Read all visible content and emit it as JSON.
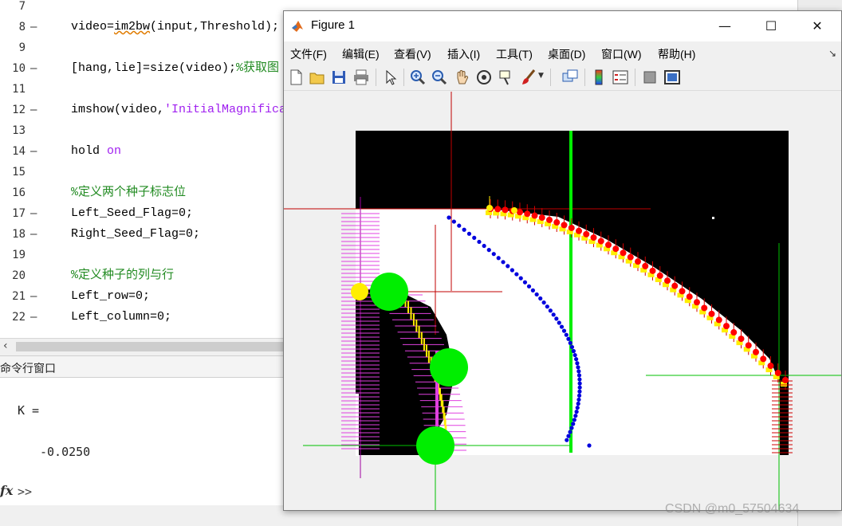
{
  "editor": {
    "lines": [
      {
        "num": "7",
        "dash": "",
        "parts": []
      },
      {
        "num": "8",
        "dash": "—",
        "parts": [
          {
            "t": "video=",
            "c": ""
          },
          {
            "t": "im2bw",
            "c": "squig"
          },
          {
            "t": "(input,Threshold);",
            "c": ""
          }
        ]
      },
      {
        "num": "9",
        "dash": "",
        "parts": []
      },
      {
        "num": "10",
        "dash": "—",
        "parts": [
          {
            "t": "[hang,lie]=size(video);",
            "c": ""
          },
          {
            "t": "%获取图",
            "c": "cmt"
          }
        ]
      },
      {
        "num": "11",
        "dash": "",
        "parts": []
      },
      {
        "num": "12",
        "dash": "—",
        "parts": [
          {
            "t": "imshow(video,",
            "c": ""
          },
          {
            "t": "'InitialMagnifica",
            "c": "str"
          }
        ]
      },
      {
        "num": "13",
        "dash": "",
        "parts": []
      },
      {
        "num": "14",
        "dash": "—",
        "parts": [
          {
            "t": "hold ",
            "c": ""
          },
          {
            "t": "on",
            "c": "kw"
          }
        ]
      },
      {
        "num": "15",
        "dash": "",
        "parts": []
      },
      {
        "num": "16",
        "dash": "",
        "parts": [
          {
            "t": "%定义两个种子标志位",
            "c": "cmt"
          }
        ]
      },
      {
        "num": "17",
        "dash": "—",
        "parts": [
          {
            "t": "Left_Seed_Flag=0;",
            "c": ""
          }
        ]
      },
      {
        "num": "18",
        "dash": "—",
        "parts": [
          {
            "t": "Right_Seed_Flag=0;",
            "c": ""
          }
        ]
      },
      {
        "num": "19",
        "dash": "",
        "parts": []
      },
      {
        "num": "20",
        "dash": "",
        "parts": [
          {
            "t": "%定义种子的列与行",
            "c": "cmt"
          }
        ]
      },
      {
        "num": "21",
        "dash": "—",
        "parts": [
          {
            "t": "Left_row=0;",
            "c": ""
          }
        ]
      },
      {
        "num": "22",
        "dash": "—",
        "parts": [
          {
            "t": "Left_column=0;",
            "c": ""
          }
        ]
      }
    ]
  },
  "command_window": {
    "header": "命令行窗口",
    "output_var": "K =",
    "output_value": "-0.0250",
    "prompt": ">>",
    "fx_label": "fx"
  },
  "figure": {
    "title": "Figure 1",
    "controls": {
      "minimize": "—",
      "maximize": "☐",
      "close": "✕"
    },
    "menus": [
      "文件(F)",
      "编辑(E)",
      "查看(V)",
      "插入(I)",
      "工具(T)",
      "桌面(D)",
      "窗口(W)",
      "帮助(H)"
    ],
    "toolbar_icons": [
      "new-figure-icon",
      "open-file-icon",
      "save-icon",
      "print-icon",
      "pointer-icon",
      "zoom-in-icon",
      "zoom-out-icon",
      "pan-icon",
      "rotate-3d-icon",
      "data-cursor-icon",
      "brush-icon",
      "link-plot-icon",
      "colorbar-icon",
      "legend-icon",
      "hide-plot-tools-icon",
      "show-plot-tools-icon"
    ]
  },
  "colors": {
    "keyword": "#a020f0",
    "comment": "#228b22",
    "seed_point": "#00ee00",
    "right_edge": "#ff0000",
    "center_line": "#0000dd",
    "highlight": "#ffee00",
    "left_edge": "#e040e0"
  },
  "watermark": "CSDN @m0_57504634"
}
